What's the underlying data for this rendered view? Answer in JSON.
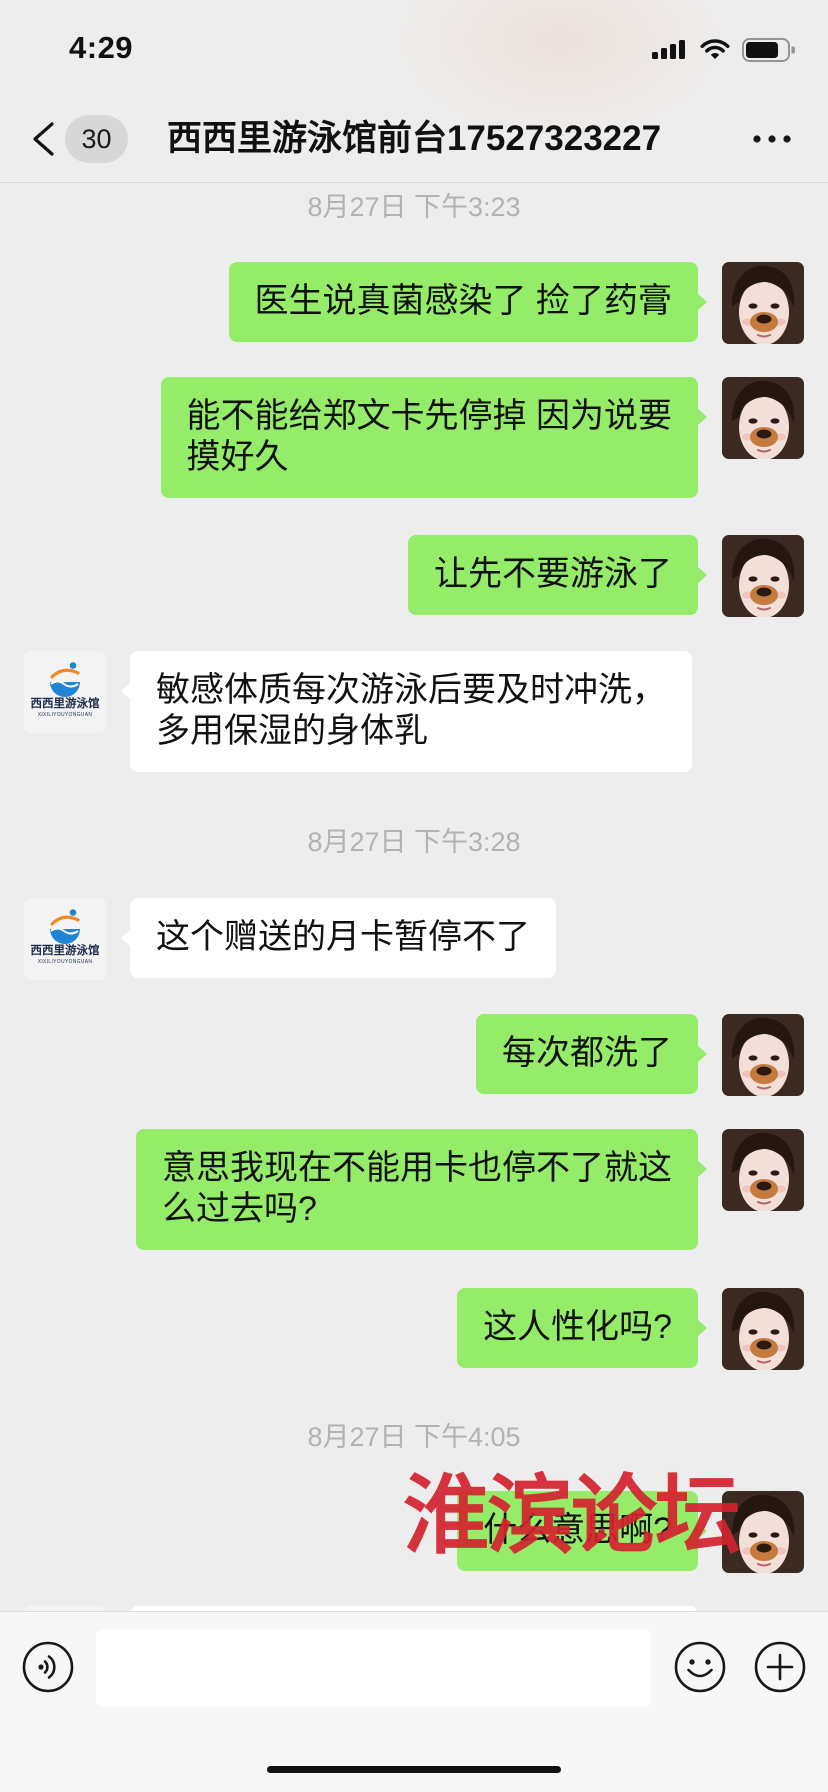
{
  "status_bar": {
    "time": "4:29",
    "battery_level": 0.8,
    "icons": [
      "cellular-signal-icon",
      "wifi-icon",
      "battery-icon"
    ]
  },
  "nav": {
    "back_icon": "chevron-left-icon",
    "unread_badge": "30",
    "title": "西西里游泳馆前台17527323227",
    "more_icon": "more-icon"
  },
  "contact_logo": {
    "name": "西西里游泳馆",
    "pinyin": "XIXILIYOUYONGUAN"
  },
  "chat": {
    "timestamps": [
      "8月27日 下午3:23",
      "8月27日 下午3:28",
      "8月27日 下午4:05"
    ],
    "messages": [
      {
        "lines": [
          "医生说真菌感染了 捡了药膏"
        ]
      },
      {
        "lines": [
          "能不能给郑文卡先停掉 因为说要",
          "摸好久"
        ]
      },
      {
        "lines": [
          "让先不要游泳了"
        ]
      },
      {
        "lines": [
          "敏感体质每次游泳后要及时冲洗，",
          "多用保湿的身体乳"
        ]
      },
      {
        "lines": [
          "这个赠送的月卡暂停不了"
        ]
      },
      {
        "lines": [
          "每次都洗了"
        ]
      },
      {
        "lines": [
          "意思我现在不能用卡也停不了就这",
          "么过去吗?"
        ]
      },
      {
        "lines": [
          "这人性化吗?"
        ]
      },
      {
        "lines": [
          "什么意思啊?"
        ]
      }
    ]
  },
  "watermark": "淮滨论坛",
  "input_bar": {
    "value": "",
    "left_icon": "voice-icon",
    "right_icons": [
      "emoji-icon",
      "plus-icon"
    ]
  },
  "colors": {
    "background": "#ededed",
    "self_bubble": "#95ec69",
    "contact_bubble": "#ffffff",
    "timestamp": "#b2b2b2",
    "watermark": "#d4232f"
  }
}
